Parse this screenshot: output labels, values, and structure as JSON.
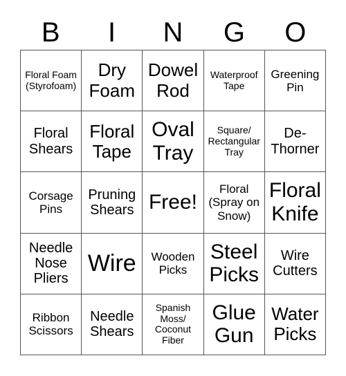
{
  "card": {
    "header": [
      "B",
      "I",
      "N",
      "G",
      "O"
    ],
    "rows": [
      [
        "Floral Foam\n(Styrofoam)",
        "Dry\nFoam",
        "Dowel\nRod",
        "Waterproof\nTape",
        "Greening\nPin"
      ],
      [
        "Floral\nShears",
        "Floral\nTape",
        "Oval\nTray",
        "Square/\nRectangular\nTray",
        "De-\nThorner"
      ],
      [
        "Corsage\nPins",
        "Pruning\nShears",
        "Free!",
        "Floral\n(Spray on\nSnow)",
        "Floral\nKnife"
      ],
      [
        "Needle\nNose\nPliers",
        "Wire",
        "Wooden\nPicks",
        "Steel\nPicks",
        "Wire\nCutters"
      ],
      [
        "Ribbon\nScissors",
        "Needle\nShears",
        "Spanish\nMoss/\nCoconut\nFiber",
        "Glue\nGun",
        "Water\nPicks"
      ]
    ],
    "sizes": [
      [
        "xs",
        "lg",
        "lg",
        "xs",
        "sm"
      ],
      [
        "md",
        "lg",
        "xl",
        "xs",
        "md"
      ],
      [
        "sm",
        "md",
        "xl",
        "sm",
        "xl"
      ],
      [
        "md",
        "xxl",
        "sm",
        "xl",
        "md"
      ],
      [
        "sm",
        "md",
        "xs",
        "xl",
        "lg"
      ]
    ]
  }
}
